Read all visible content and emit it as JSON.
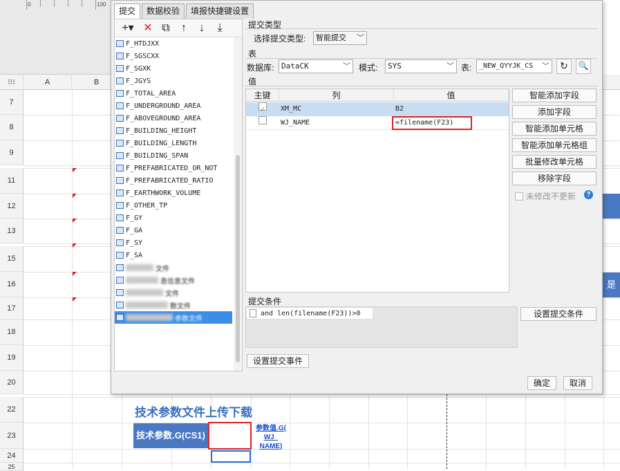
{
  "ruler": {
    "marks": [
      "0",
      "100"
    ]
  },
  "sheet": {
    "columns": [
      "A",
      "B"
    ],
    "rows": [
      "7",
      "8",
      "9",
      "11",
      "12",
      "13",
      "15",
      "16",
      "17",
      "18",
      "19",
      "20",
      "22",
      "23",
      "24",
      "25"
    ],
    "title": "技术参数文件上传下载",
    "param_cell": "技术参数.G(CS1)",
    "param_link": "参数值.G( WJ_ NAME)",
    "blue_bar_text": "是",
    "accent_color": "#4a78c2"
  },
  "dialog": {
    "tabs": [
      "提交",
      "数据校验",
      "填报快捷键设置"
    ],
    "toolbar": {
      "icons": [
        "add-icon",
        "delete-icon",
        "copy-icon",
        "up-arrow-icon",
        "down-arrow-icon",
        "move-bottom-icon"
      ],
      "add": "+▾",
      "delete": "✕",
      "copy": "⧉",
      "up": "↑",
      "down": "↓",
      "bottom": "⤓"
    },
    "fields": [
      "F_HTDJXX",
      "F_SGSCXX",
      "F_SGXK",
      "F_JGYS",
      "F_TOTAL_AREA",
      "F_UNDERGROUND_AREA",
      "F_ABOVEGROUND_AREA",
      "F_BUILDING_HEIGHT",
      "F_BUILDING_LENGTH",
      "F_BUILDING_SPAN",
      "F_PREFABRICATED_OR_NOT",
      "F_PREFABRICATED_RATIO",
      "F_EARTHWORK_VOLUME",
      "F_OTHER_TP",
      "F_GY",
      "F_GA",
      "F_SY",
      "F_SA"
    ],
    "blurred_fields": [
      "文件",
      "息信息文件",
      "文件",
      "数文件",
      "参数文件"
    ],
    "submit_type_section": "提交类型",
    "submit_type_label": "选择提交类型:",
    "submit_type_value": "智能提交",
    "table_section": "表",
    "database_label": "数据库:",
    "database_value": "DataCK",
    "mode_label": "模式:",
    "mode_value": "SYS",
    "table_label": "表:",
    "table_value": "_NEW_QYYJK_CS",
    "value_section": "值",
    "grid_headers": {
      "key": "主键",
      "column": "列",
      "value": "值"
    },
    "grid_rows": [
      {
        "key_checked": true,
        "check": "✓",
        "column": "XM_MC",
        "value": "B2"
      },
      {
        "key_checked": false,
        "check": "",
        "column": "WJ_NAME",
        "value": "=filename(F23)"
      }
    ],
    "side_buttons": [
      "智能添加字段",
      "添加字段",
      "智能添加单元格",
      "智能添加单元格组",
      "批量修改单元格",
      "移除字段"
    ],
    "no_update_label": "未修改不更新",
    "help": "?",
    "condition_section": "提交条件",
    "condition_text": "and len(filename(F23))>0",
    "set_condition_button": "设置提交条件",
    "set_event_button": "设置提交事件",
    "ok_button": "确定",
    "cancel_button": "取消"
  }
}
